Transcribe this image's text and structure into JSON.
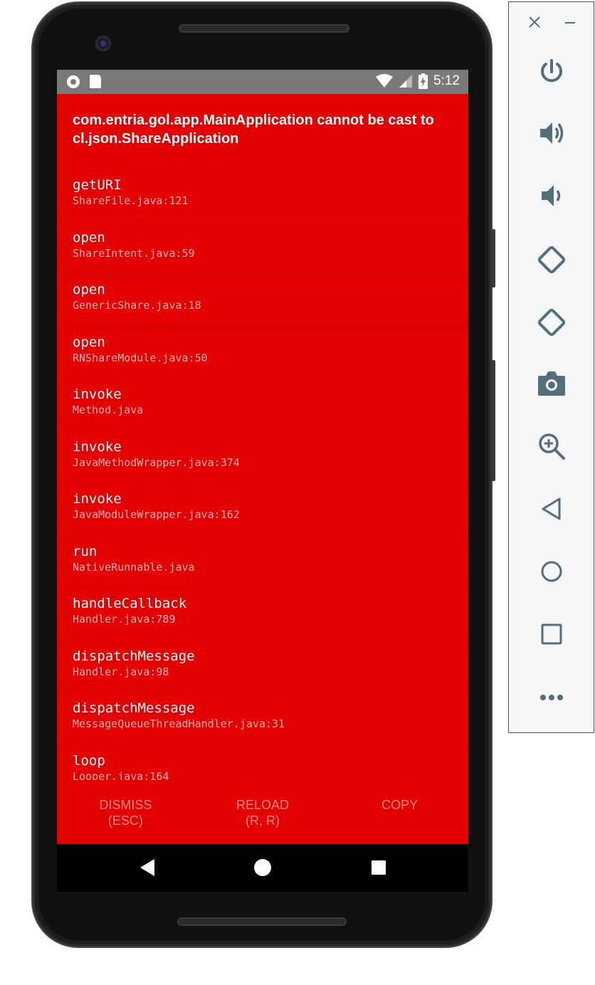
{
  "status_bar": {
    "time": "5:12"
  },
  "error": {
    "title": "com.entria.gol.app.MainApplication cannot be cast to cl.json.ShareApplication"
  },
  "stack": [
    {
      "method": "getURI",
      "file": "ShareFile.java:121"
    },
    {
      "method": "open",
      "file": "ShareIntent.java:59"
    },
    {
      "method": "open",
      "file": "GenericShare.java:18"
    },
    {
      "method": "open",
      "file": "RNShareModule.java:50"
    },
    {
      "method": "invoke",
      "file": "Method.java"
    },
    {
      "method": "invoke",
      "file": "JavaMethodWrapper.java:374"
    },
    {
      "method": "invoke",
      "file": "JavaModuleWrapper.java:162"
    },
    {
      "method": "run",
      "file": "NativeRunnable.java"
    },
    {
      "method": "handleCallback",
      "file": "Handler.java:789"
    },
    {
      "method": "dispatchMessage",
      "file": "Handler.java:98"
    },
    {
      "method": "dispatchMessage",
      "file": "MessageQueueThreadHandler.java:31"
    },
    {
      "method": "loop",
      "file": "Looper.java:164"
    }
  ],
  "actions": {
    "dismiss_line1": "DISMISS",
    "dismiss_line2": "(ESC)",
    "reload_line1": "RELOAD",
    "reload_line2": "(R, R)",
    "copy": "COPY"
  },
  "emulator_toolbar": {
    "icons": [
      "close-icon",
      "minimize-icon",
      "power-icon",
      "volume-up-icon",
      "volume-down-icon",
      "rotate-left-icon",
      "rotate-right-icon",
      "camera-icon",
      "zoom-icon",
      "back-icon",
      "home-icon",
      "overview-icon",
      "more-icon"
    ]
  },
  "colors": {
    "error_background": "#e40000",
    "status_bar": "#797979",
    "action_text": "#ff8a8a",
    "toolbar_icon": "#546e7a"
  }
}
